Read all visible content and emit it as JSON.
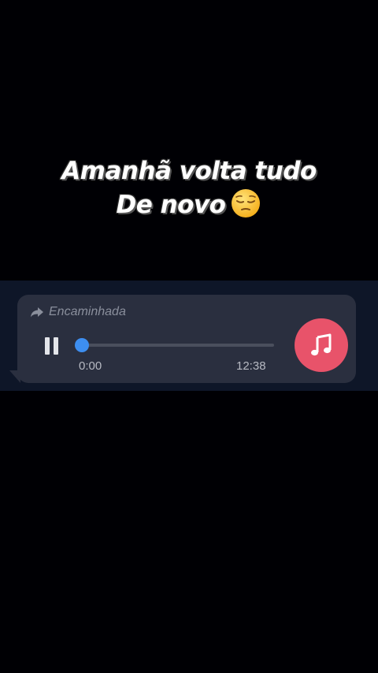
{
  "caption": {
    "line1": "Amanhã volta tudo",
    "line2": "De novo",
    "emoji": "pensive-face-emoji"
  },
  "message": {
    "forwarded_label": "Encaminhada",
    "forwarded_icon": "forward-arrow-icon",
    "player": {
      "state_icon": "pause-icon",
      "elapsed": "0:00",
      "duration": "12:38",
      "progress_fraction": 0.0,
      "accent_color": "#3d8ef0"
    },
    "media_icon": "music-note-icon",
    "media_icon_color": "#e8536a"
  }
}
